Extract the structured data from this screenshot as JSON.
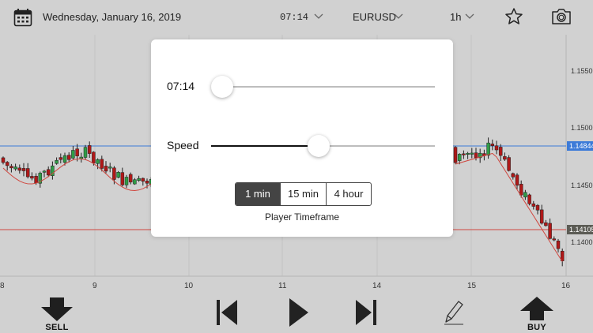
{
  "header": {
    "date": "Wednesday, January 16, 2019",
    "time": "07:14",
    "symbol": "EURUSD",
    "timeframe": "1h"
  },
  "chart": {
    "y_ticks": [
      "1.1550",
      "1.1500",
      "1.1450",
      "1.1400"
    ],
    "x_ticks": [
      "8",
      "9",
      "10",
      "11",
      "14",
      "15",
      "16"
    ],
    "blue_line_label": "1.14844",
    "red_line_label": "1.14105",
    "colors": {
      "bull": "#2f9c46",
      "bear": "#b01818",
      "blue_line": "#3d7bd8",
      "red_line": "#d0463e"
    }
  },
  "player": {
    "time_label": "07:14",
    "time_progress": 0.05,
    "speed_label": "Speed",
    "speed_progress": 0.48,
    "timeframe_options": [
      "1 min",
      "15 min",
      "4 hour"
    ],
    "selected_timeframe": "1 min",
    "timeframe_caption": "Player Timeframe"
  },
  "bottom": {
    "sell_label": "SELL",
    "buy_label": "BUY"
  },
  "icons": [
    "calendar-icon",
    "chevron-down-icon",
    "star-icon",
    "camera-icon",
    "sell-arrow-icon",
    "skip-back-icon",
    "play-icon",
    "skip-forward-icon",
    "pencil-icon",
    "buy-arrow-icon"
  ]
}
